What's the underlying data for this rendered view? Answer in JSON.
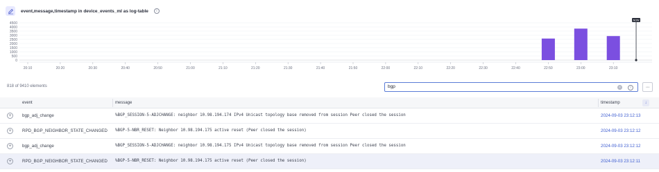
{
  "header": {
    "title": "event,message,timestamp in device_events_ml as log-table",
    "info_glyph": "i"
  },
  "chart_data": {
    "type": "bar",
    "y_ticks": [
      "4500",
      "4000",
      "3500",
      "3000",
      "2500",
      "2000",
      "1500",
      "1000",
      "500",
      "0"
    ],
    "ylim": [
      0,
      4500
    ],
    "x_ticks": [
      "20:10",
      "20:20",
      "20:30",
      "20:40",
      "20:50",
      "21:00",
      "21:10",
      "21:20",
      "21:30",
      "21:40",
      "21:50",
      "22:00",
      "22:10",
      "22:20",
      "22:30",
      "22:40",
      "22:50",
      "23:00",
      "23:10"
    ],
    "bars": [
      {
        "x": "22:50",
        "value": 2600
      },
      {
        "x": "23:00",
        "value": 3800
      },
      {
        "x": "23:10",
        "value": 2900
      }
    ],
    "marker_label": "NOW",
    "marker_x_offset_minutes": 7,
    "bar_color": "#7b4fe0",
    "grid": true
  },
  "results": {
    "count_text": "818 of 9410 elements"
  },
  "search": {
    "value": "bgp",
    "clear_glyph": "×",
    "help_glyph": "i"
  },
  "more_button": {
    "label": "···"
  },
  "table": {
    "columns": [
      "event",
      "message",
      "timestamp"
    ],
    "sort_glyph": "↓",
    "expand_glyph": "+",
    "rows": [
      {
        "event": "bgp_adj_change",
        "message": "%BGP_SESSION-5-ADJCHANGE: neighbor 10.98.194.174 IPv4 Unicast topology base removed from session Peer closed the session",
        "timestamp": "2024-09-03 23:12:13"
      },
      {
        "event": "RPD_BGP_NEIGHBOR_STATE_CHANGED",
        "message": "%BGP-5-NBR_RESET: Neighbor 10.98.194.175 active reset (Peer closed the session)",
        "timestamp": "2024-09-03 23:12:12"
      },
      {
        "event": "bgp_adj_change",
        "message": "%BGP_SESSION-5-ADJCHANGE: neighbor 10.98.194.175 IPv4 Unicast topology base removed from session Peer closed the session",
        "timestamp": "2024-09-03 23:12:12"
      },
      {
        "event": "RPD_BGP_NEIGHBOR_STATE_CHANGED",
        "message": "%BGP-5-NBR_RESET: Neighbor 10.98.194.175 active reset (Peer closed the session)",
        "timestamp": "2024-09-03 23:12:11"
      }
    ]
  },
  "colors": {
    "accent": "#5a7bd6",
    "bar": "#7b4fe0",
    "timestamp_link": "#3b5bd0",
    "row_highlight": "#eef0f9"
  }
}
